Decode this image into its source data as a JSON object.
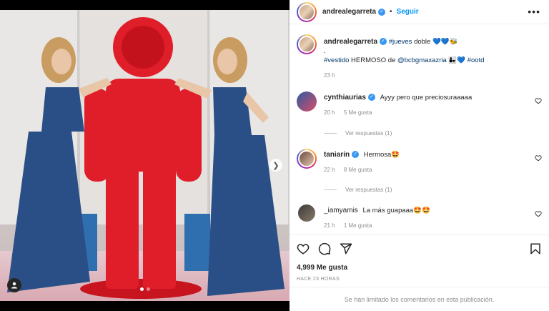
{
  "post": {
    "author": "andrealegarreta",
    "follow_label": "Seguir",
    "more_label": "•••",
    "caption_parts": [
      "#jueves",
      "doble 💙💙🐝"
    ],
    "caption_dot": ".",
    "caption_line2": [
      "#vestido",
      "HERMOSO de",
      "@bcbgmaxazria",
      "👨‍👧💙",
      "#ootd"
    ],
    "caption_time": "23 h",
    "likes": "4,999 Me gusta",
    "timestamp": "HACE 23 HORAS",
    "comments_limited": "Se han limitado los comentarios en esta publicación."
  },
  "comments": [
    {
      "user": "cynthiaurias",
      "verified": true,
      "text": "Ayyy pero que preciosuraaaaa",
      "time": "20 h",
      "likes": "5 Me gusta",
      "replies": "Ver respuestas (1)"
    },
    {
      "user": "taniarin",
      "verified": true,
      "text": "Hermosa🤩",
      "time": "22 h",
      "likes": "8 Me gusta",
      "replies": "Ver respuestas (1)"
    },
    {
      "user": "_iamyamis",
      "verified": false,
      "text": "La más guapaaa🤩🤩",
      "time": "21 h",
      "likes": "1 Me gusta"
    }
  ],
  "carousel": {
    "index": 1,
    "total": 2
  },
  "colors": {
    "link": "#00376b",
    "accent": "#0095f6",
    "figure": "#e01e2a",
    "dress": "#2a4f86"
  },
  "icons": [
    "heart-icon",
    "comment-icon",
    "share-icon",
    "bookmark-icon",
    "more-icon",
    "user-tag-icon",
    "chevron-right-icon",
    "verified-icon"
  ]
}
